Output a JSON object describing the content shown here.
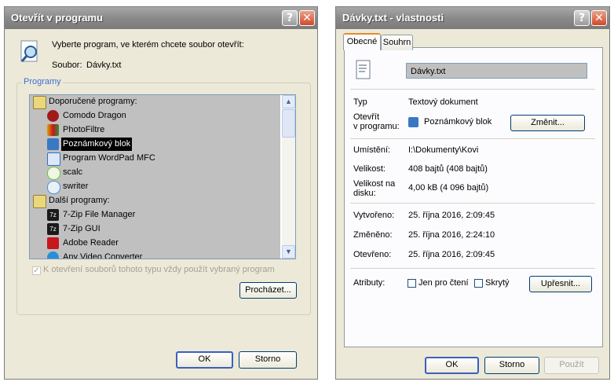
{
  "open_with": {
    "title": "Otevřít v programu",
    "instruction": "Vyberte program, ve kterém chcete soubor otevřít:",
    "file_label": "Soubor:",
    "file_name": "Dávky.txt",
    "group_title": "Programy",
    "recommended_header": "Doporučené programy:",
    "recommended": [
      {
        "label": "Comodo Dragon",
        "icon": "dragon-icon",
        "color": "#a11a1a"
      },
      {
        "label": "PhotoFiltre",
        "icon": "photofiltre-icon",
        "color": "#d9a400"
      },
      {
        "label": "Poznámkový blok",
        "icon": "notepad-icon",
        "color": "#3a78c3",
        "selected": true
      },
      {
        "label": "Program WordPad MFC",
        "icon": "wordpad-icon",
        "color": "#2f6fc7"
      },
      {
        "label": "scalc",
        "icon": "scalc-icon",
        "color": "#6fbf3a"
      },
      {
        "label": "swriter",
        "icon": "swriter-icon",
        "color": "#4b8fd6"
      }
    ],
    "other_header": "Další programy:",
    "other": [
      {
        "label": "7-Zip File Manager",
        "icon": "7zip-icon",
        "color": "#1a1a1a"
      },
      {
        "label": "7-Zip GUI",
        "icon": "7zip-gui-icon",
        "color": "#1a1a1a"
      },
      {
        "label": "Adobe Reader",
        "icon": "adobe-reader-icon",
        "color": "#c8161d"
      },
      {
        "label": "Any Video Converter",
        "icon": "video-converter-icon",
        "color": "#2a8fd6"
      }
    ],
    "always_use_label": "K otevření souborů tohoto typu vždy použít vybraný program",
    "always_use_checked": true,
    "browse_label": "Procházet...",
    "ok_label": "OK",
    "cancel_label": "Storno",
    "help_glyph": "?",
    "close_glyph": "✕"
  },
  "properties": {
    "title": "Dávky.txt - vlastnosti",
    "tabs": [
      "Obecné",
      "Souhrn"
    ],
    "file_name": "Dávky.txt",
    "type_label": "Typ",
    "type_value": "Textový dokument",
    "opens_with_label_1": "Otevřít",
    "opens_with_label_2": "v programu:",
    "opens_with_value": "Poznámkový blok",
    "change_label": "Změnit...",
    "location_label": "Umístění:",
    "location_value": "I:\\Dokumenty\\Kovi",
    "size_label": "Velikost:",
    "size_value": "408 bajtů (408 bajtů)",
    "disk_size_label_1": "Velikost na",
    "disk_size_label_2": "disku:",
    "disk_size_value": "4,00 kB (4 096 bajtů)",
    "created_label": "Vytvořeno:",
    "created_value": "25. října 2016, 2:09:45",
    "modified_label": "Změněno:",
    "modified_value": "25. října 2016, 2:24:10",
    "accessed_label": "Otevřeno:",
    "accessed_value": "25. října 2016, 2:09:45",
    "attributes_label": "Atributy:",
    "readonly_label": "Jen pro čtení",
    "hidden_label": "Skrytý",
    "advanced_label": "Upřesnit...",
    "ok_label": "OK",
    "cancel_label": "Storno",
    "apply_label": "Použít",
    "help_glyph": "?",
    "close_glyph": "✕"
  }
}
